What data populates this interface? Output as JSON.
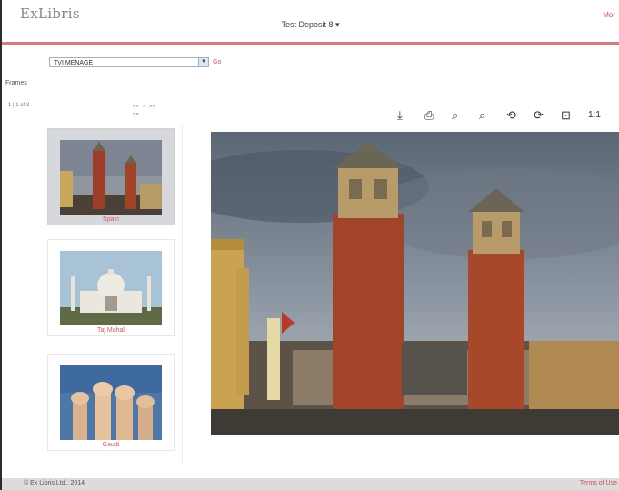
{
  "header": {
    "logo": "ExLibris",
    "deposit_menu": "Test Deposit 8 ▾",
    "login_text": "Mor"
  },
  "toolbar_select": {
    "value": "TVI MENAGE",
    "go_label": "Go"
  },
  "frames": {
    "label": "Frames",
    "pager": "1  |  1 of 3",
    "nav_icons": [
      "««",
      "»",
      "»»",
      "»»"
    ]
  },
  "thumbnails": [
    {
      "caption": "Spain"
    },
    {
      "caption": "Taj Mahal"
    },
    {
      "caption": "Gaudi"
    }
  ],
  "viewer_toolbar": {
    "icons": [
      "download-icon",
      "print-icon",
      "zoom-in-icon",
      "zoom-out-icon",
      "rotate-left-icon",
      "rotate-right-icon",
      "fit-window-icon",
      "actual-size-icon"
    ],
    "actual_size": "1:1"
  },
  "footer": {
    "copyright": "© Ex Libris Ltd., 2014",
    "terms": "Terms of Use"
  }
}
